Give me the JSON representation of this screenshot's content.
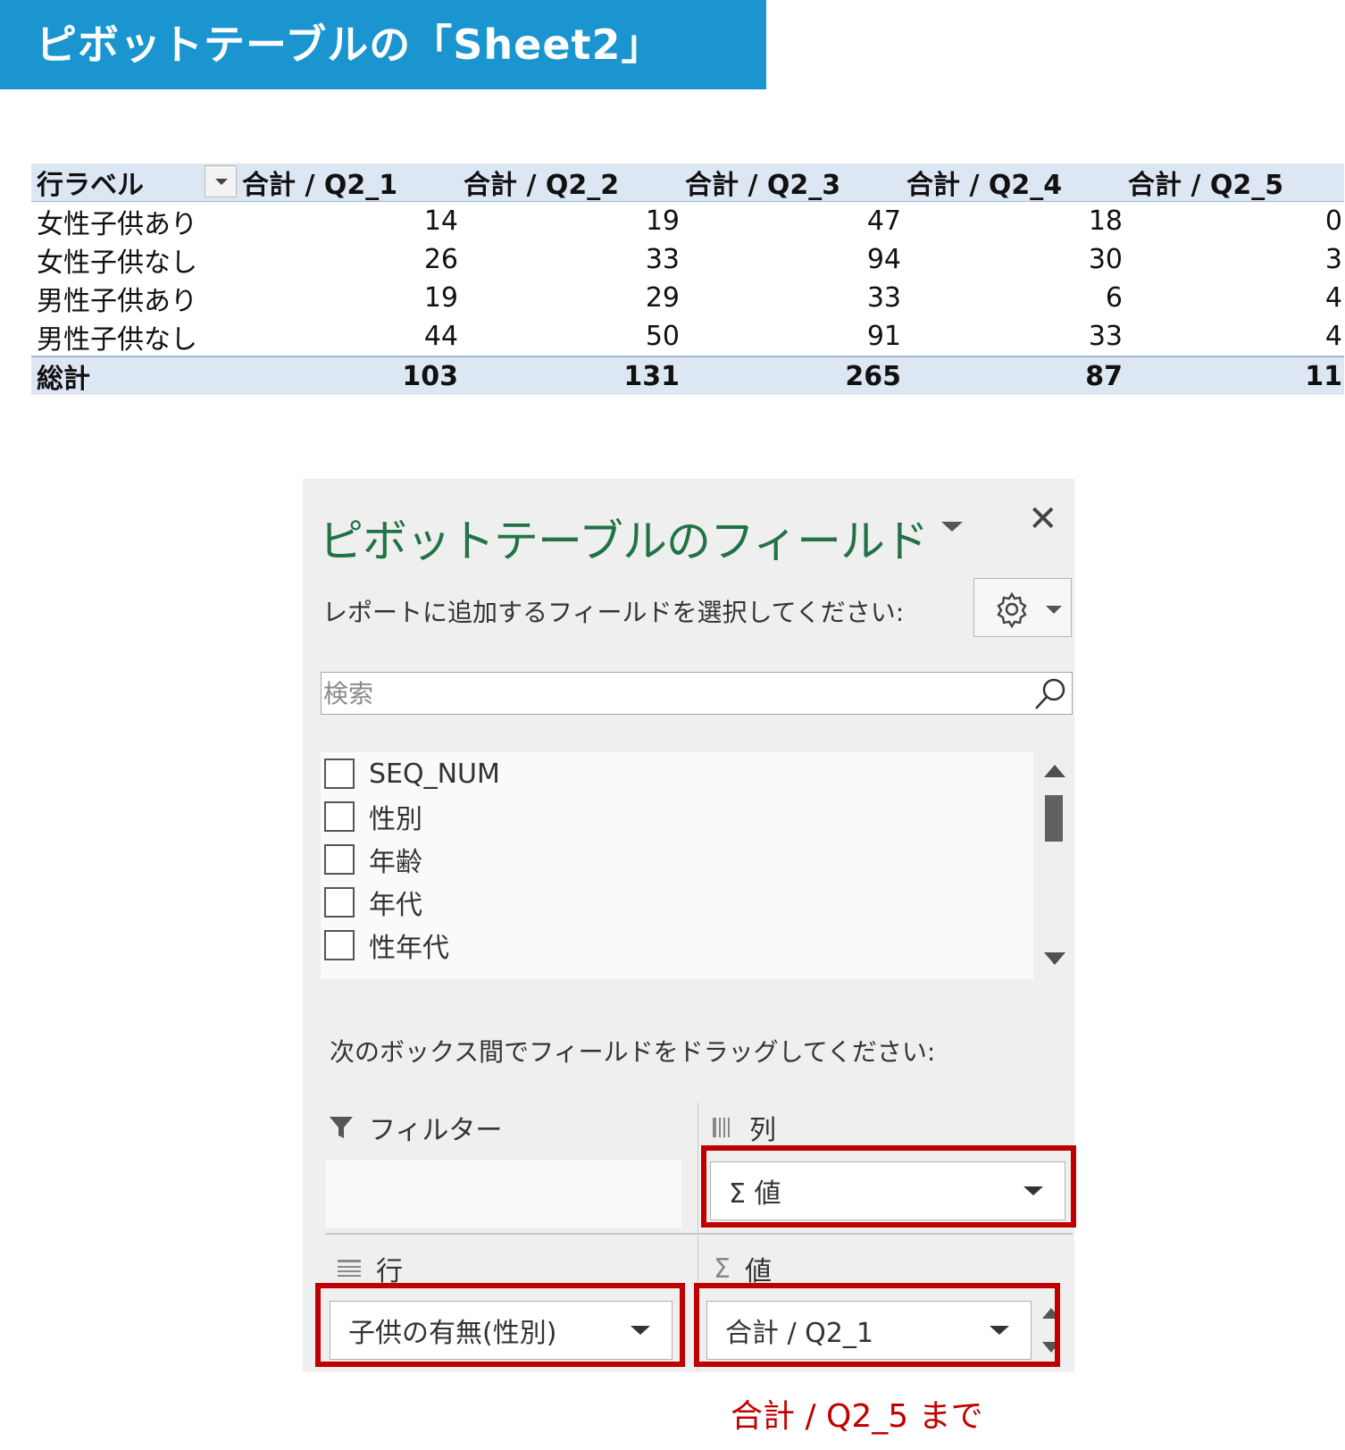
{
  "banner": {
    "title": "ピボットテーブルの「Sheet2」"
  },
  "pivot": {
    "row_label_header": "行ラベル",
    "columns": [
      "合計 / Q2_1",
      "合計 / Q2_2",
      "合計 / Q2_3",
      "合計 / Q2_4",
      "合計 / Q2_5"
    ],
    "rows": [
      {
        "label": "女性子供あり",
        "values": [
          "14",
          "19",
          "47",
          "18",
          "0"
        ]
      },
      {
        "label": "女性子供なし",
        "values": [
          "26",
          "33",
          "94",
          "30",
          "3"
        ]
      },
      {
        "label": "男性子供あり",
        "values": [
          "19",
          "29",
          "33",
          "6",
          "4"
        ]
      },
      {
        "label": "男性子供なし",
        "values": [
          "44",
          "50",
          "91",
          "33",
          "4"
        ]
      }
    ],
    "total": {
      "label": "総計",
      "values": [
        "103",
        "131",
        "265",
        "87",
        "11"
      ]
    }
  },
  "pane": {
    "title": "ピボットテーブルのフィールド",
    "close_glyph": "✕",
    "instruction_select": "レポートに追加するフィールドを選択してください:",
    "search_placeholder": "検索",
    "fields": [
      "SEQ_NUM",
      "性別",
      "年齢",
      "年代",
      "性年代"
    ],
    "instruction_drag": "次のボックス間でフィールドをドラッグしてください:",
    "areas": {
      "filter": {
        "label": "フィルター"
      },
      "columns": {
        "label": "列",
        "item": "Σ 値"
      },
      "rows": {
        "label": "行",
        "item": "子供の有無(性別)"
      },
      "values": {
        "label": "値",
        "label_icon": "Σ",
        "item": "合計 / Q2_1"
      }
    }
  },
  "annotation": {
    "note": "合計 / Q2_5 まで"
  },
  "colors": {
    "banner": "#1a95cf",
    "pane_title": "#217346",
    "highlight": "#c00000",
    "pivot_header": "#dde7f3"
  }
}
